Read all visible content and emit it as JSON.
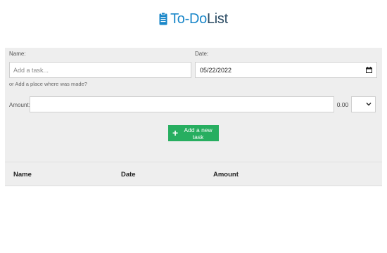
{
  "header": {
    "title_part1": "To-Do",
    "title_part2": "List",
    "icon": "clipboard-icon"
  },
  "form": {
    "name_label": "Name:",
    "name_placeholder": "Add a task...",
    "date_label": "Date:",
    "date_value": "05/22/2022",
    "hint": "or Add a place where was made?",
    "amount_label": "Amount:",
    "amount_value": "",
    "amount_display": "0.00",
    "currency_selected": ""
  },
  "button": {
    "add_label": "Add a new task",
    "icon": "plus-icon"
  },
  "table": {
    "columns": [
      "Name",
      "Date",
      "Amount"
    ]
  },
  "colors": {
    "accent": "#1a87c9",
    "button": "#27ae60",
    "panel": "#eeeeee"
  }
}
